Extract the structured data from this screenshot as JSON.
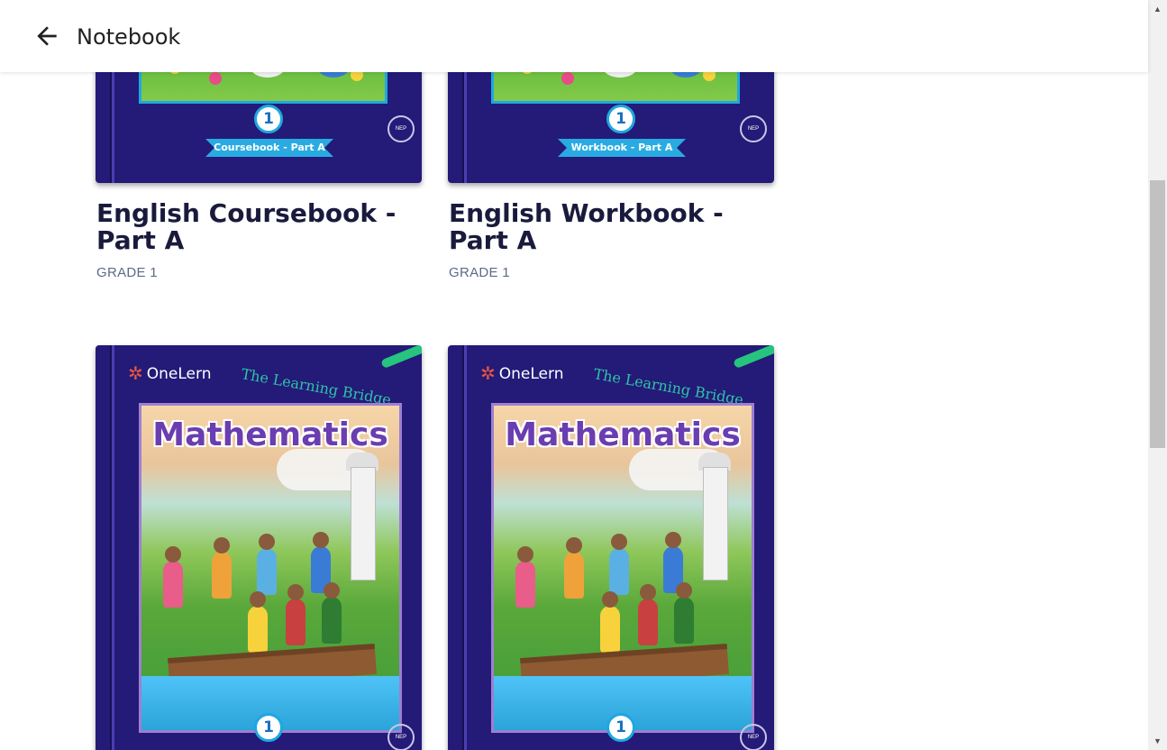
{
  "header": {
    "back_label": "Back",
    "title": "Notebook"
  },
  "books": [
    {
      "title": "English Coursebook - Part A",
      "grade": "GRADE 1",
      "cover": {
        "grade_number": "1",
        "ribbon_text": "Coursebook - Part A",
        "badge": "NEP",
        "accent": "#29abe2"
      }
    },
    {
      "title": "English Workbook - Part A",
      "grade": "GRADE 1",
      "cover": {
        "grade_number": "1",
        "ribbon_text": "Workbook - Part A",
        "badge": "NEP",
        "accent": "#29abe2"
      }
    },
    {
      "cover": {
        "brand": "OneLern",
        "tagline": "The Learning Bridge",
        "subject": "Mathematics",
        "grade_number": "1",
        "badge": "NEP",
        "accent": "#9d7fd1"
      }
    },
    {
      "cover": {
        "brand": "OneLern",
        "tagline": "The Learning Bridge",
        "subject": "Mathematics",
        "grade_number": "1",
        "badge": "NEP",
        "accent": "#9d7fd1"
      }
    }
  ],
  "colors": {
    "cover_bg": "#241a78",
    "title_text": "#1a1a3d",
    "grade_text": "#5b6b86"
  }
}
